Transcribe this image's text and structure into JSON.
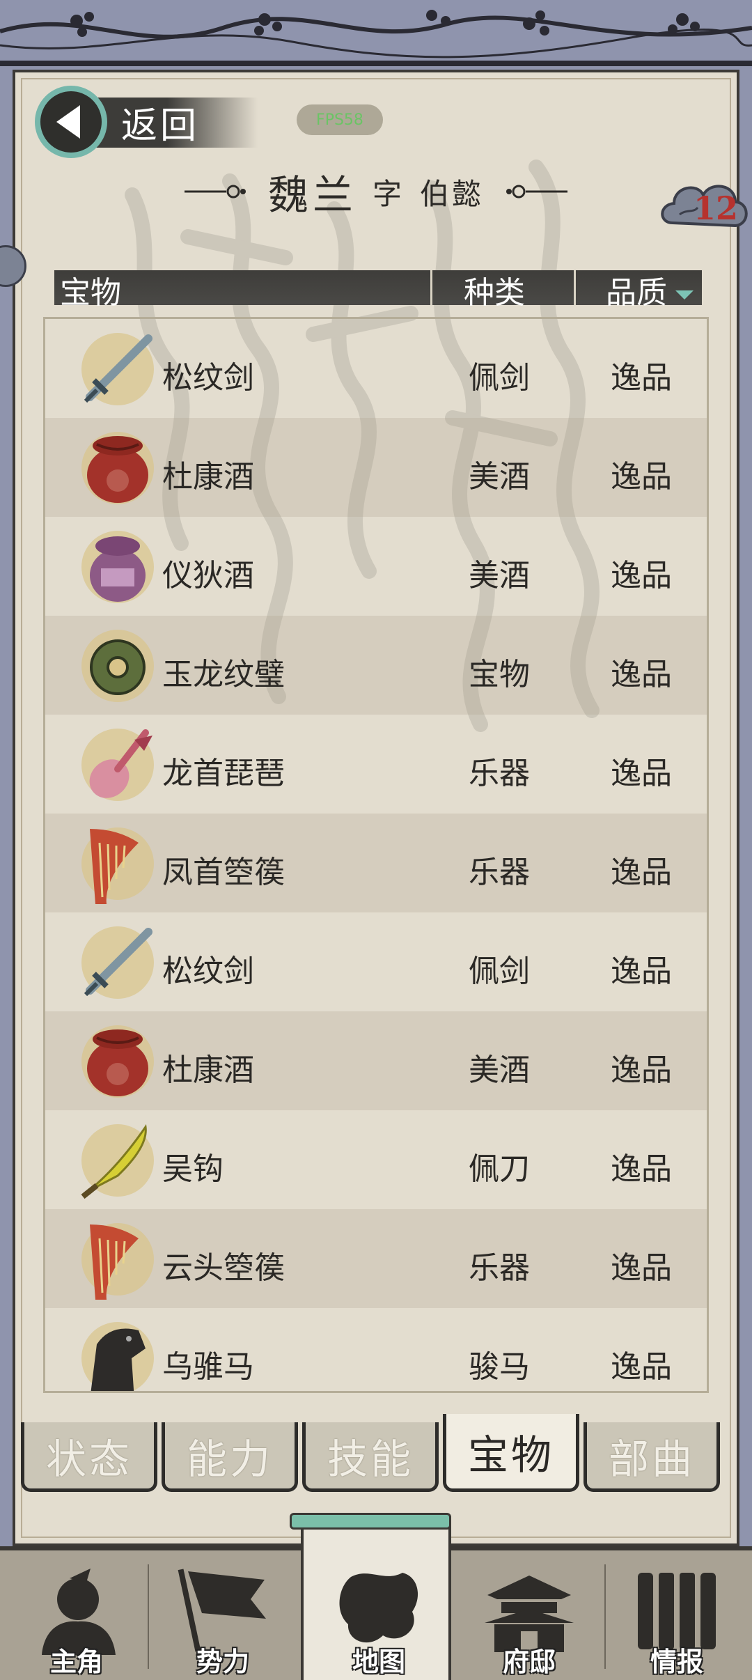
{
  "header": {
    "back_label": "返回",
    "fps_label": "FPS58",
    "name": "魏兰",
    "courtesy_prefix": "字",
    "courtesy_name": "伯懿",
    "badge_count": "12"
  },
  "table": {
    "col_item": "宝物",
    "col_type": "种类",
    "col_quality": "品质",
    "rows": [
      {
        "name": "松纹剑",
        "type": "佩剑",
        "quality": "逸品",
        "icon": "sword-icon"
      },
      {
        "name": "杜康酒",
        "type": "美酒",
        "quality": "逸品",
        "icon": "red-wine-jar-icon"
      },
      {
        "name": "仪狄酒",
        "type": "美酒",
        "quality": "逸品",
        "icon": "purple-wine-jar-icon"
      },
      {
        "name": "玉龙纹璧",
        "type": "宝物",
        "quality": "逸品",
        "icon": "jade-disc-icon"
      },
      {
        "name": "龙首琵琶",
        "type": "乐器",
        "quality": "逸品",
        "icon": "pipa-icon"
      },
      {
        "name": "凤首箜篌",
        "type": "乐器",
        "quality": "逸品",
        "icon": "harp-icon"
      },
      {
        "name": "松纹剑",
        "type": "佩剑",
        "quality": "逸品",
        "icon": "sword-icon"
      },
      {
        "name": "杜康酒",
        "type": "美酒",
        "quality": "逸品",
        "icon": "red-wine-jar-icon"
      },
      {
        "name": "吴钩",
        "type": "佩刀",
        "quality": "逸品",
        "icon": "saber-icon"
      },
      {
        "name": "云头箜篌",
        "type": "乐器",
        "quality": "逸品",
        "icon": "harp-icon"
      },
      {
        "name": "乌骓马",
        "type": "骏马",
        "quality": "逸品",
        "icon": "horse-icon"
      }
    ]
  },
  "tabs": [
    {
      "label": "状态",
      "active": false
    },
    {
      "label": "能力",
      "active": false
    },
    {
      "label": "技能",
      "active": false
    },
    {
      "label": "宝物",
      "active": true
    },
    {
      "label": "部曲",
      "active": false
    }
  ],
  "nav": [
    {
      "label": "主角",
      "icon": "hero-icon"
    },
    {
      "label": "势力",
      "icon": "flag-icon"
    },
    {
      "label": "地图",
      "icon": "map-icon",
      "active": true
    },
    {
      "label": "府邸",
      "icon": "mansion-icon"
    },
    {
      "label": "情报",
      "icon": "scroll-icon"
    }
  ],
  "colors": {
    "paper": "#e3ddcf",
    "frame": "#8f94ad",
    "accent": "#76b7ab",
    "badge_text": "#b6322e"
  }
}
